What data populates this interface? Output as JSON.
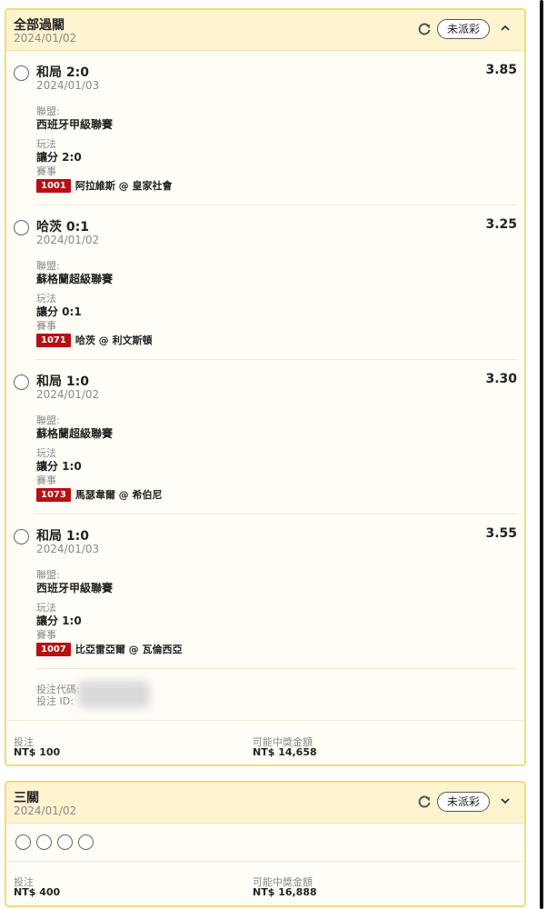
{
  "parlay_all": {
    "title": "全部過關",
    "date": "2024/01/02",
    "status": "未派彩",
    "legs": [
      {
        "name": "和局 2:0",
        "date": "2024/01/03",
        "odds": "3.85",
        "league_label": "聯盟:",
        "league": "西班牙甲級聯賽",
        "market_label": "玩法",
        "market": "讓分 2:0",
        "event_label": "賽事",
        "code": "1001",
        "match": "阿拉維斯 @ 皇家社會"
      },
      {
        "name": "哈茨 0:1",
        "date": "2024/01/02",
        "odds": "3.25",
        "league_label": "聯盟:",
        "league": "蘇格蘭超級聯賽",
        "market_label": "玩法",
        "market": "讓分 0:1",
        "event_label": "賽事",
        "code": "1071",
        "match": "哈茨 @ 利文斯頓"
      },
      {
        "name": "和局 1:0",
        "date": "2024/01/02",
        "odds": "3.30",
        "league_label": "聯盟:",
        "league": "蘇格蘭超級聯賽",
        "market_label": "玩法",
        "market": "讓分 1:0",
        "event_label": "賽事",
        "code": "1073",
        "match": "馬瑟韋爾 @ 希伯尼"
      },
      {
        "name": "和局 1:0",
        "date": "2024/01/03",
        "odds": "3.55",
        "league_label": "聯盟:",
        "league": "西班牙甲級聯賽",
        "market_label": "玩法",
        "market": "讓分 1:0",
        "event_label": "賽事",
        "code": "1007",
        "match": "比亞雷亞爾 @ 瓦倫西亞"
      }
    ],
    "bet_code_label": "投注代碼:",
    "bet_id_label": "投注 ID:",
    "stake_label": "投注",
    "stake": "NT$ 100",
    "payout_label": "可能中獎金額",
    "payout": "NT$ 14,658"
  },
  "parlay_three": {
    "title": "三關",
    "date": "2024/01/02",
    "status": "未派彩",
    "leg_count": 4,
    "stake_label": "投注",
    "stake": "NT$ 400",
    "payout_label": "可能中獎金額",
    "payout": "NT$ 16,888"
  },
  "icons": {
    "refresh": "refresh-icon",
    "collapse": "chevron-up-icon",
    "expand": "chevron-down-icon"
  },
  "colors": {
    "header_bg": "#fdf3cf",
    "border": "#f2dc7c",
    "code_badge": "#b80f13"
  }
}
